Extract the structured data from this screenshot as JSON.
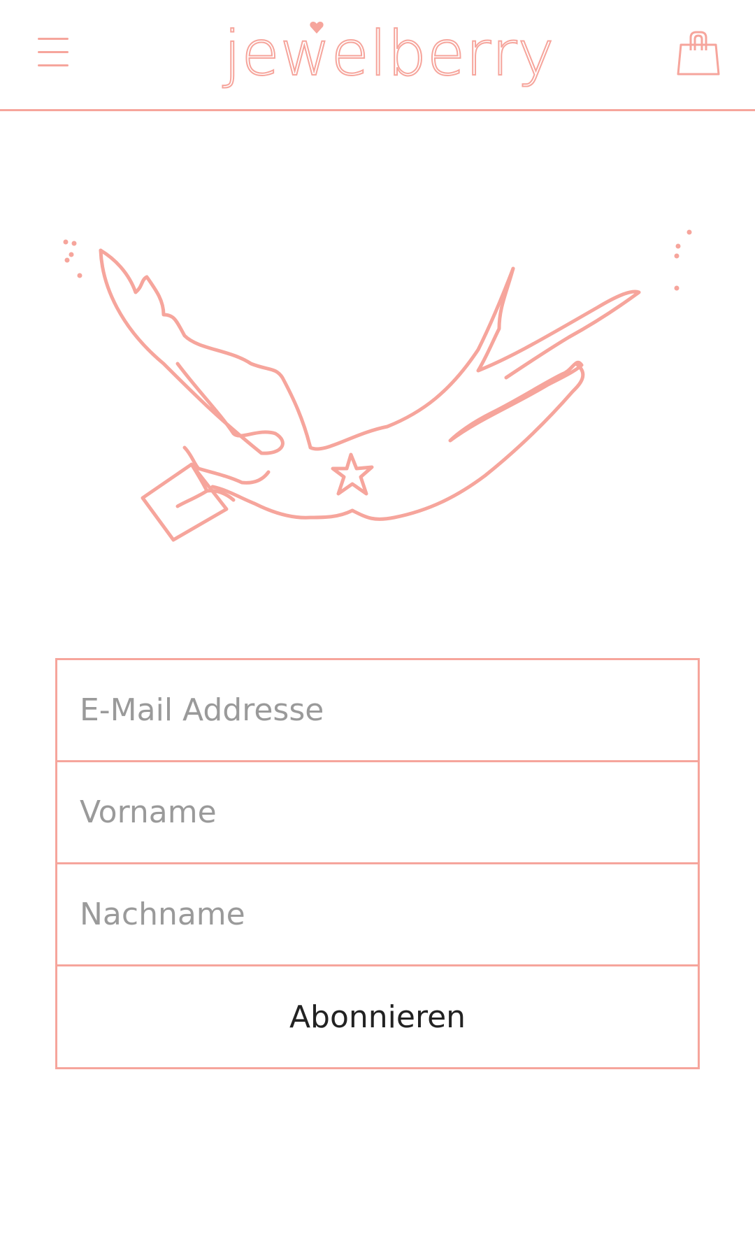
{
  "brand": {
    "logo_text": "jewelberry",
    "accent_color": "#f6a59c"
  },
  "header": {
    "menu_icon": "hamburger-menu-icon",
    "cart_icon": "shopping-bag-icon"
  },
  "hero": {
    "illustration": "swallow-carrying-letter-illustration"
  },
  "signup_form": {
    "email_placeholder": "E-Mail Addresse",
    "email_value": "",
    "first_name_placeholder": "Vorname",
    "first_name_value": "",
    "last_name_placeholder": "Nachname",
    "last_name_value": "",
    "submit_label": "Abonnieren"
  }
}
